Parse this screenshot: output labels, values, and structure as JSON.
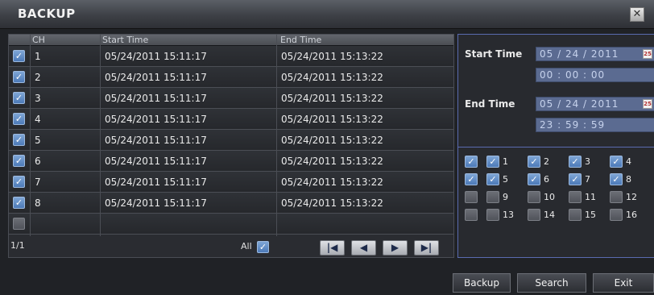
{
  "window": {
    "title": "BACKUP",
    "close_glyph": "✕"
  },
  "table": {
    "columns": {
      "ch": "CH",
      "start": "Start Time",
      "end": "End Time"
    },
    "rows": [
      {
        "checked": true,
        "ch": "1",
        "start": "05/24/2011 15:11:17",
        "end": "05/24/2011 15:13:22"
      },
      {
        "checked": true,
        "ch": "2",
        "start": "05/24/2011 15:11:17",
        "end": "05/24/2011 15:13:22"
      },
      {
        "checked": true,
        "ch": "3",
        "start": "05/24/2011 15:11:17",
        "end": "05/24/2011 15:13:22"
      },
      {
        "checked": true,
        "ch": "4",
        "start": "05/24/2011 15:11:17",
        "end": "05/24/2011 15:13:22"
      },
      {
        "checked": true,
        "ch": "5",
        "start": "05/24/2011 15:11:17",
        "end": "05/24/2011 15:13:22"
      },
      {
        "checked": true,
        "ch": "6",
        "start": "05/24/2011 15:11:17",
        "end": "05/24/2011 15:13:22"
      },
      {
        "checked": true,
        "ch": "7",
        "start": "05/24/2011 15:11:17",
        "end": "05/24/2011 15:13:22"
      },
      {
        "checked": true,
        "ch": "8",
        "start": "05/24/2011 15:11:17",
        "end": "05/24/2011 15:13:22"
      },
      {
        "checked": false,
        "ch": "",
        "start": "",
        "end": ""
      }
    ],
    "page_indicator": "1/1",
    "all_label": "All",
    "all_checked": true
  },
  "pager": {
    "first": "|◀",
    "prev": "◀",
    "next": "▶",
    "last": "▶|"
  },
  "search_panel": {
    "start_label": "Start Time",
    "start_date": "05 / 24 / 2011",
    "start_time": "00 : 00 : 00",
    "end_label": "End Time",
    "end_date": "05 / 24 / 2011",
    "end_time": "23 : 59 : 59",
    "calendar_glyph": "25",
    "channels": [
      {
        "num": "1",
        "checked": true
      },
      {
        "num": "2",
        "checked": true
      },
      {
        "num": "3",
        "checked": true
      },
      {
        "num": "4",
        "checked": true
      },
      {
        "num": "5",
        "checked": true
      },
      {
        "num": "6",
        "checked": true
      },
      {
        "num": "7",
        "checked": true
      },
      {
        "num": "8",
        "checked": true
      },
      {
        "num": "9",
        "checked": false
      },
      {
        "num": "10",
        "checked": false
      },
      {
        "num": "11",
        "checked": false
      },
      {
        "num": "12",
        "checked": false
      },
      {
        "num": "13",
        "checked": false
      },
      {
        "num": "14",
        "checked": false
      },
      {
        "num": "15",
        "checked": false
      },
      {
        "num": "16",
        "checked": false
      }
    ],
    "row_all_checked": [
      true,
      true,
      false,
      false
    ]
  },
  "buttons": {
    "backup": "Backup",
    "search": "Search",
    "exit": "Exit"
  },
  "colors": {
    "accent": "#5a6bb0",
    "checkbox": "#4c7ab8",
    "field": "#5b6b91"
  },
  "icons": {
    "close": "close-icon",
    "calendar": "calendar-icon",
    "check": "checkmark-icon"
  }
}
